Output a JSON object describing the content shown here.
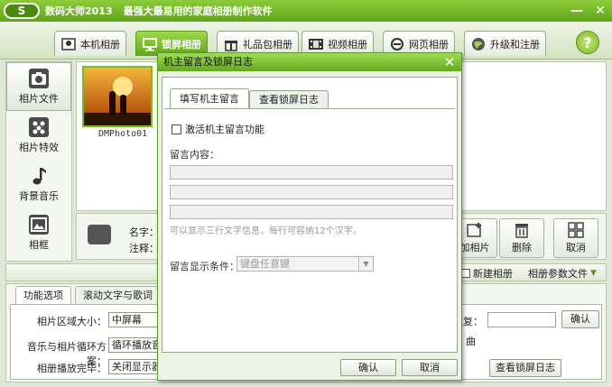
{
  "app": {
    "title": "数码大师2013",
    "slogan": "最强大最易用的家庭相册制作软件",
    "logo": "S"
  },
  "window_controls": {
    "minimize_icon": "minimize-icon",
    "close_icon": "close-icon",
    "minimize_glyph": "—",
    "close_glyph": "✕"
  },
  "nav": {
    "tabs": [
      {
        "label": "本机相册",
        "icon": "photo-album-icon"
      },
      {
        "label": "锁屏相册",
        "icon": "monitor-icon",
        "active": true
      },
      {
        "label": "礼品包相册",
        "icon": "gift-icon"
      },
      {
        "label": "视频相册",
        "icon": "film-icon"
      },
      {
        "label": "网页相册",
        "icon": "ie-icon"
      },
      {
        "label": "升级和注册",
        "icon": "globe-icon"
      }
    ],
    "help": "?"
  },
  "sidebar": {
    "items": [
      {
        "label": "相片文件",
        "icon": "camera-icon",
        "active": true
      },
      {
        "label": "相片特效",
        "icon": "effects-icon"
      },
      {
        "label": "背景音乐",
        "icon": "music-note-icon"
      },
      {
        "label": "相框",
        "icon": "picture-frame-icon"
      }
    ]
  },
  "photos": {
    "items": [
      {
        "name": "DMPhoto01"
      }
    ]
  },
  "detail": {
    "name_label": "名字：",
    "note_label": "注释："
  },
  "action_buttons": {
    "add_photo": "加相片",
    "delete": "删除",
    "cancel": "取消"
  },
  "toolstrip": {
    "new_album": "新建相册",
    "album_params": "相册参数文件"
  },
  "bottom": {
    "tabs": [
      "功能选项",
      "滚动文字与歌词"
    ],
    "area_size_label": "相片区域大小：",
    "area_size_value": "中屏幕",
    "loop_label": "音乐与相片循环方案：",
    "loop_value": "循环播放音",
    "after_play_label": "相册播放完毕：",
    "after_play_value": "关闭显示器",
    "repeat_label": "重复：",
    "confirm": "确认",
    "song_label": "曲",
    "view_log": "查看锁屏日志"
  },
  "dialog": {
    "title": "机主留言及锁屏日志",
    "close_glyph": "✕",
    "tabs": [
      "填写机主留言",
      "查看锁屏日志"
    ],
    "activate_label": "激活机主留言功能",
    "activate_checked": false,
    "content_label": "留言内容：",
    "lines": [
      "",
      "",
      ""
    ],
    "hint": "可以显示三行文字信息，每行可容纳12个汉字。",
    "condition_label": "留言显示条件：",
    "condition_value": "键盘任意键",
    "ok": "确认",
    "cancel": "取消"
  }
}
